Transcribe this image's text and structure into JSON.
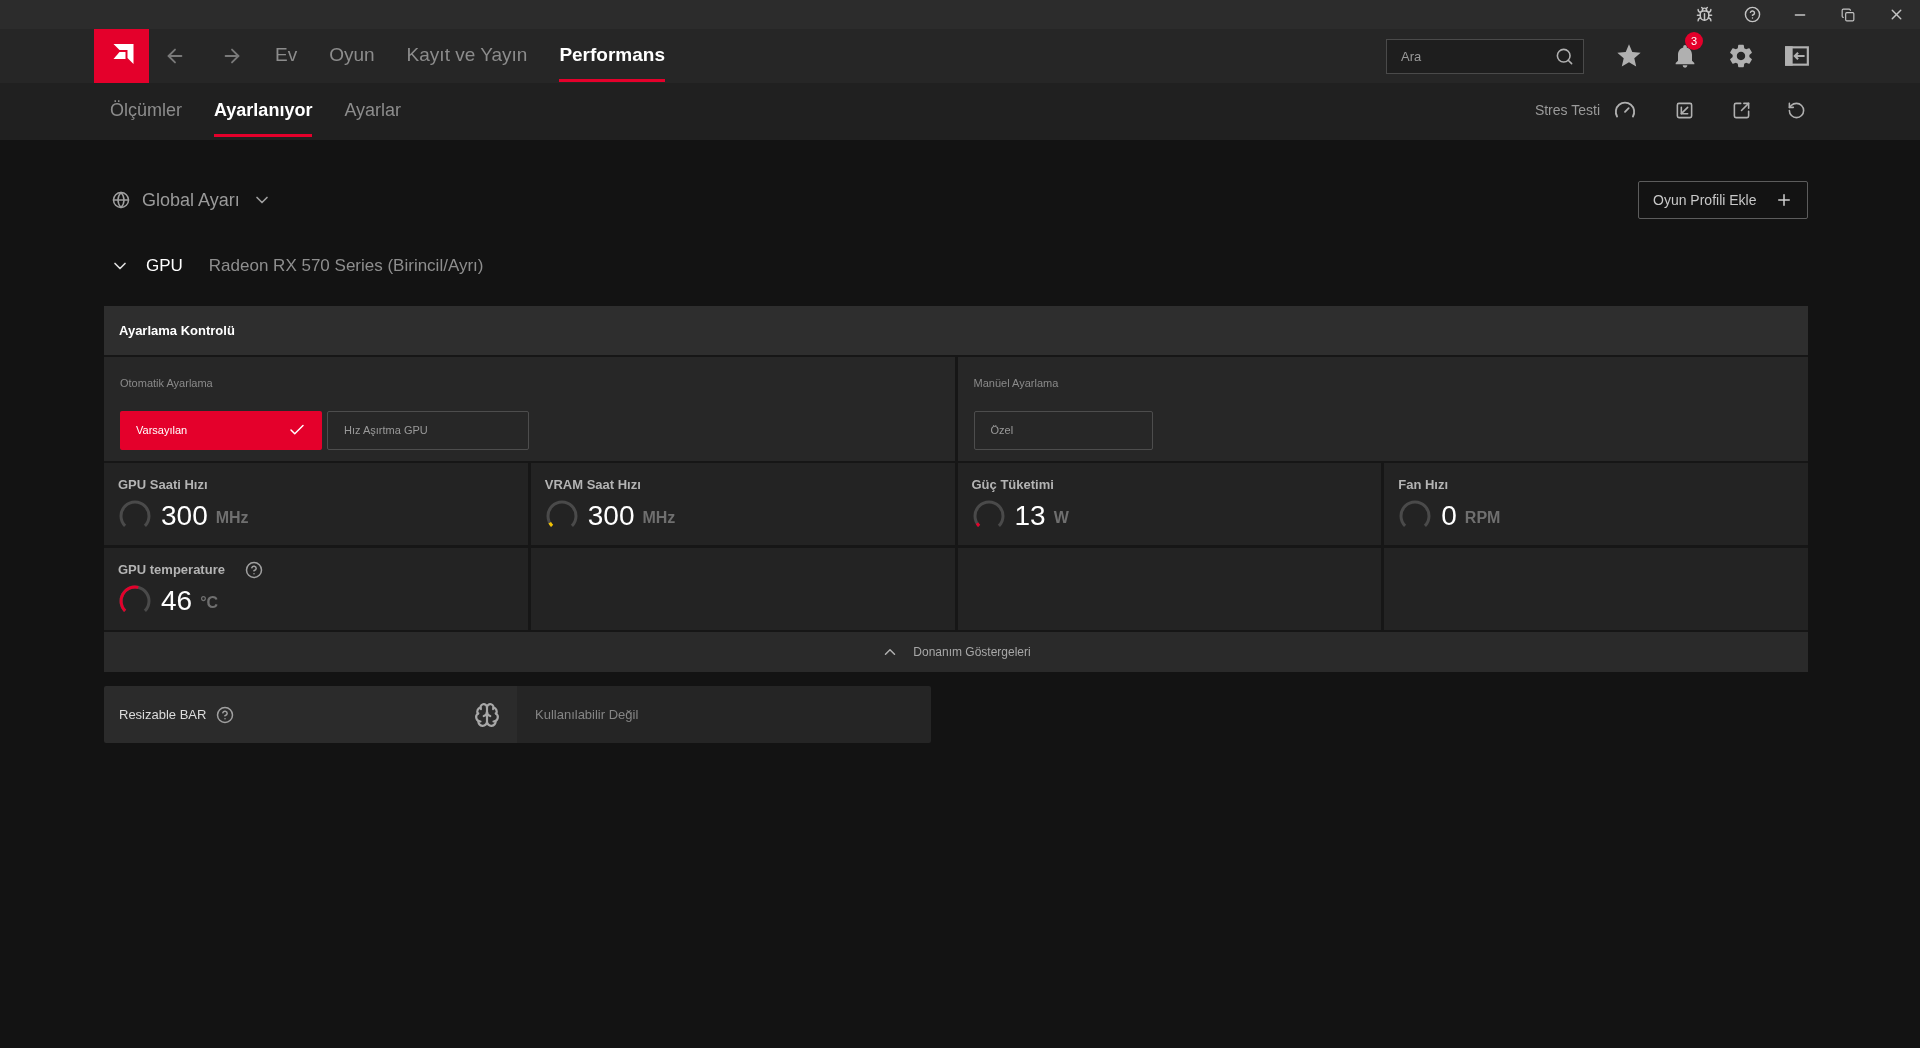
{
  "nav": {
    "tabs": [
      {
        "label": "Ev",
        "selected": false
      },
      {
        "label": "Oyun",
        "selected": false
      },
      {
        "label": "Kayıt ve Yayın",
        "selected": false
      },
      {
        "label": "Performans",
        "selected": true
      }
    ]
  },
  "search": {
    "placeholder": "Ara"
  },
  "notifications": {
    "count": "3"
  },
  "subnav": {
    "tabs": [
      {
        "label": "Ölçümler",
        "selected": false
      },
      {
        "label": "Ayarlanıyor",
        "selected": true
      },
      {
        "label": "Ayarlar",
        "selected": false
      }
    ],
    "stress_test": "Stres Testi"
  },
  "profile": {
    "label": "Global Ayarı",
    "add_button": "Oyun Profili Ekle"
  },
  "gpu": {
    "label": "GPU",
    "name": "Radeon RX 570 Series (Birincil/Ayrı)",
    "expanded": true
  },
  "tuning": {
    "title": "Ayarlama Kontrolü",
    "auto": {
      "label": "Otomatik Ayarlama",
      "options": [
        {
          "label": "Varsayılan",
          "selected": true
        },
        {
          "label": "Hız Aşırtma GPU",
          "selected": false
        }
      ]
    },
    "manual": {
      "label": "Manüel Ayarlama",
      "options": [
        {
          "label": "Özel",
          "selected": false
        }
      ]
    },
    "metrics": [
      {
        "label": "GPU Saati Hızı",
        "value": "300",
        "unit": "MHz",
        "level": 0,
        "help": false
      },
      {
        "label": "VRAM Saat Hızı",
        "value": "300",
        "unit": "MHz",
        "level": 0.06,
        "color": "#f2c200",
        "help": false
      },
      {
        "label": "Güç Tüketimi",
        "value": "13",
        "unit": "W",
        "level": 0.05,
        "color": "#e4002b",
        "help": false
      },
      {
        "label": "Fan Hızı",
        "value": "0",
        "unit": "RPM",
        "level": 0,
        "help": false
      },
      {
        "label": "GPU temperature",
        "value": "46",
        "unit": "°C",
        "level": 0.55,
        "color": "#e4002b",
        "help": true
      }
    ],
    "footer": {
      "label": "Donanım Göstergeleri",
      "expanded": true
    }
  },
  "resizable_bar": {
    "label": "Resizable BAR",
    "value": "Kullanılabilir Değil"
  }
}
